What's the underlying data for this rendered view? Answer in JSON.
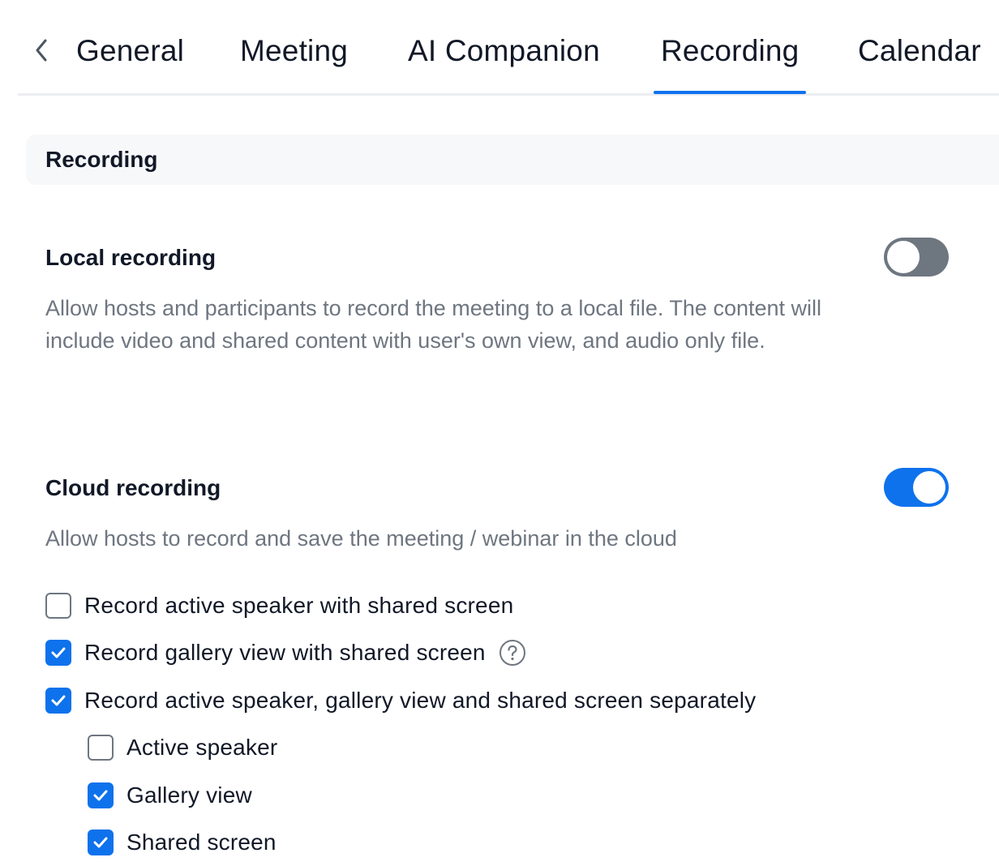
{
  "tabs": [
    {
      "label": "General"
    },
    {
      "label": "Meeting"
    },
    {
      "label": "AI Companion"
    },
    {
      "label": "Recording",
      "active": true
    },
    {
      "label": "Calendar"
    }
  ],
  "section": {
    "title": "Recording"
  },
  "local_recording": {
    "title": "Local recording",
    "description": "Allow hosts and participants to record the meeting to a local file. The content will include video and shared content with user's own view, and audio only file.",
    "enabled": false
  },
  "cloud_recording": {
    "title": "Cloud recording",
    "description": "Allow hosts to record and save the meeting / webinar in the cloud",
    "enabled": true,
    "options": [
      {
        "label": "Record active speaker with shared screen",
        "checked": false
      },
      {
        "label": "Record gallery view with shared screen",
        "checked": true
      },
      {
        "label": "Record active speaker, gallery view and shared screen separately",
        "checked": true
      }
    ],
    "sub_options": [
      {
        "label": "Active speaker",
        "checked": false
      },
      {
        "label": "Gallery view",
        "checked": true
      },
      {
        "label": "Shared screen",
        "checked": true
      }
    ]
  },
  "icons": {
    "back": "chevron-left-icon",
    "help": "question-circle-icon",
    "check": "checkmark-icon"
  },
  "colors": {
    "accent": "#0e72ed",
    "toggle_off": "#6e7680",
    "muted_text": "#6e7680"
  }
}
